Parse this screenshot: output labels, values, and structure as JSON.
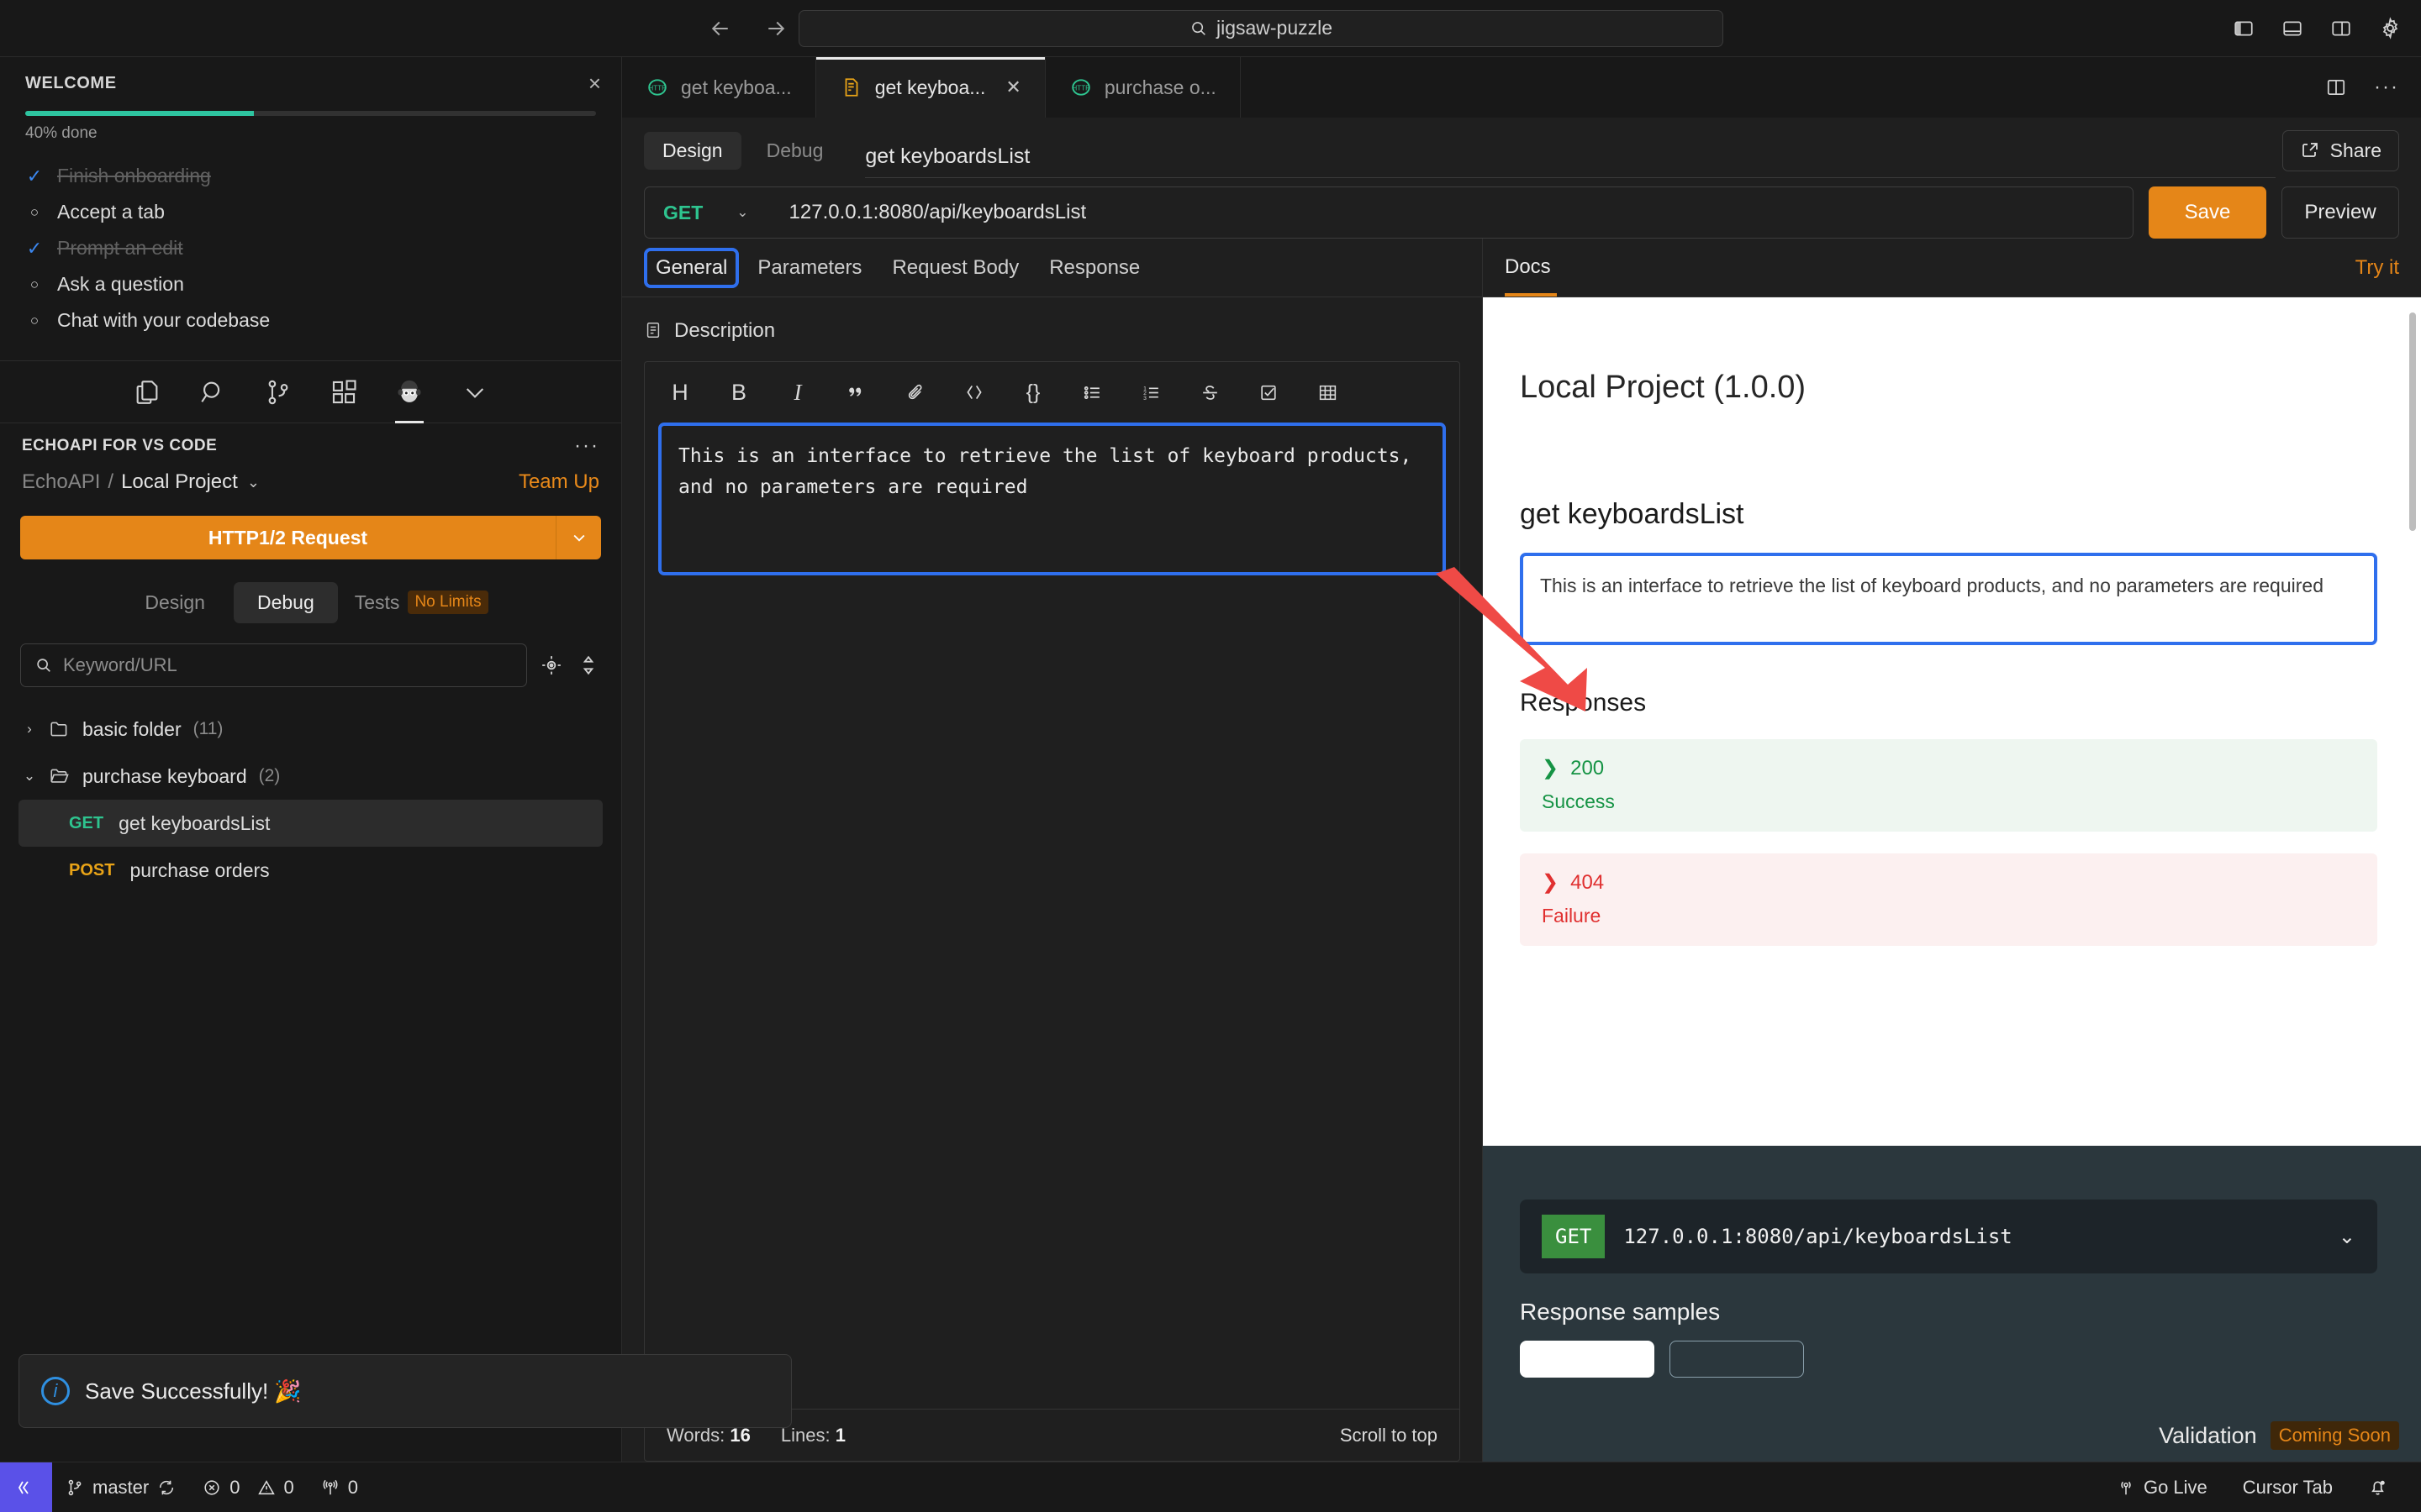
{
  "titlebar": {
    "back_icon": "arrow-left-icon",
    "forward_icon": "arrow-right-icon",
    "search_value": "jigsaw-puzzle",
    "search_icon": "search-icon",
    "layout_icons": [
      "toggle-primary-sidebar-icon",
      "toggle-panel-icon",
      "toggle-secondary-sidebar-icon",
      "gear-icon"
    ]
  },
  "welcome": {
    "title": "WELCOME",
    "close_icon": "close-icon",
    "progress_percent": 40,
    "progress_label": "40% done",
    "progress_color": "#2ec4a0",
    "items": [
      {
        "label": "Finish onboarding",
        "done": true
      },
      {
        "label": "Accept a tab",
        "done": false
      },
      {
        "label": "Prompt an edit",
        "done": true
      },
      {
        "label": "Ask a question",
        "done": false
      },
      {
        "label": "Chat with your codebase",
        "done": false
      }
    ]
  },
  "activitybar": {
    "icons": [
      {
        "name": "explorer-icon",
        "active": false
      },
      {
        "name": "search-icon",
        "active": false
      },
      {
        "name": "source-control-icon",
        "active": false
      },
      {
        "name": "extensions-icon",
        "active": false
      },
      {
        "name": "echoapi-monkey-icon",
        "active": true
      },
      {
        "name": "chevron-down-icon",
        "active": false
      }
    ]
  },
  "echoapi_panel": {
    "title": "ECHOAPI FOR VS CODE",
    "more_icon": "more-actions-icon",
    "breadcrumb_org": "EchoAPI",
    "breadcrumb_sep": "/",
    "breadcrumb_project": "Local Project",
    "project_caret_icon": "chevron-down-icon",
    "team_up_label": "Team Up",
    "team_up_color": "#e8891a",
    "new_request_label": "HTTP1/2 Request",
    "new_request_caret_icon": "chevron-down-icon",
    "segments": [
      {
        "label": "Design",
        "active": false
      },
      {
        "label": "Debug",
        "active": true
      },
      {
        "label": "Tests",
        "active": false,
        "badge": "No Limits"
      }
    ],
    "search_placeholder": "Keyword/URL",
    "search_icon": "search-icon",
    "search_row_icons": [
      "locate-icon",
      "sort-icon"
    ],
    "tree": [
      {
        "type": "folder",
        "label": "basic folder",
        "count": "(11)",
        "expanded": false,
        "caret_icon": "chevron-right-icon",
        "folder_icon": "folder-icon"
      },
      {
        "type": "folder",
        "label": "purchase keyboard",
        "count": "(2)",
        "expanded": true,
        "caret_icon": "chevron-down-icon",
        "folder_icon": "folder-open-icon"
      },
      {
        "type": "request",
        "method": "GET",
        "label": "get keyboardsList",
        "selected": true
      },
      {
        "type": "request",
        "method": "POST",
        "label": "purchase orders",
        "selected": false
      }
    ]
  },
  "tabs": {
    "items": [
      {
        "label": "get keyboa...",
        "icon": "http-icon",
        "active": false,
        "closable": false
      },
      {
        "label": "get keyboa...",
        "icon": "api-doc-icon",
        "active": true,
        "closable": true
      },
      {
        "label": "purchase o...",
        "icon": "http-icon",
        "active": false,
        "closable": false
      }
    ],
    "right_icons": [
      "split-editor-icon",
      "more-actions-icon"
    ]
  },
  "design_header": {
    "segments": [
      {
        "label": "Design",
        "active": true
      },
      {
        "label": "Debug",
        "active": false
      }
    ],
    "request_title": "get keyboardsList",
    "share_label": "Share",
    "share_icon": "share-icon"
  },
  "url_bar": {
    "method": "GET",
    "method_caret_icon": "chevron-down-icon",
    "url": "127.0.0.1:8080/api/keyboardsList",
    "save_label": "Save",
    "preview_label": "Preview",
    "save_color": "#e58618"
  },
  "request_tabs": [
    {
      "label": "General",
      "active": true,
      "highlighted": true
    },
    {
      "label": "Parameters",
      "active": false,
      "highlighted": false
    },
    {
      "label": "Request Body",
      "active": false,
      "highlighted": false
    },
    {
      "label": "Response",
      "active": false,
      "highlighted": false
    }
  ],
  "description_section": {
    "heading": "Description",
    "heading_icon": "document-icon",
    "toolbar_icons": [
      {
        "name": "heading-icon",
        "glyph": "H"
      },
      {
        "name": "bold-icon",
        "glyph": "B"
      },
      {
        "name": "italic-icon",
        "glyph": "I"
      },
      {
        "name": "quote-icon",
        "glyph": "“"
      },
      {
        "name": "link-icon",
        "glyph": "link"
      },
      {
        "name": "code-icon",
        "glyph": "code"
      },
      {
        "name": "code-block-icon",
        "glyph": "{}"
      },
      {
        "name": "bullet-list-icon",
        "glyph": "ul"
      },
      {
        "name": "ordered-list-icon",
        "glyph": "ol"
      },
      {
        "name": "strikethrough-icon",
        "glyph": "S"
      },
      {
        "name": "task-list-icon",
        "glyph": "task"
      },
      {
        "name": "table-icon",
        "glyph": "table"
      }
    ],
    "editor_value": "This is an interface to retrieve the list of keyboard products, and no parameters are required",
    "highlight_color": "#2f6fed",
    "footer": {
      "words_label": "Words:",
      "words_value": "16",
      "lines_label": "Lines:",
      "lines_value": "1",
      "scroll_top_label": "Scroll to top"
    }
  },
  "docs_panel": {
    "tab_label": "Docs",
    "try_it_label": "Try it",
    "accent_color": "#e58618",
    "project_title": "Local Project (1.0.0)",
    "api_title": "get keyboardsList",
    "description": "This is an interface to retrieve the list of keyboard products, and no parameters are required",
    "responses_heading": "Responses",
    "responses": [
      {
        "code": "200",
        "label": "Success",
        "status": "ok",
        "caret_icon": "chevron-right-icon"
      },
      {
        "code": "404",
        "label": "Failure",
        "status": "error",
        "caret_icon": "chevron-right-icon"
      }
    ],
    "endpoint": {
      "method": "GET",
      "url": "127.0.0.1:8080/api/keyboardsList",
      "caret_icon": "chevron-down-icon",
      "method_color": "#3a8f3e"
    },
    "response_samples_title": "Response samples"
  },
  "toast": {
    "icon": "info-icon",
    "message": "Save Successfully!  🎉"
  },
  "validation": {
    "label": "Validation",
    "badge": "Coming Soon",
    "badge_color": "#e58618"
  },
  "statusbar": {
    "remote_icon": "remote-window-icon",
    "branch_icon": "source-control-icon",
    "branch": "master",
    "sync_icon": "sync-icon",
    "errors_icon": "error-icon",
    "errors": "0",
    "warnings_icon": "warning-icon",
    "warnings": "0",
    "ports_icon": "radio-tower-icon",
    "ports": "0",
    "go_live_icon": "broadcast-icon",
    "go_live": "Go Live",
    "cursor_tab": "Cursor Tab",
    "bell_icon": "bell-dot-icon"
  }
}
